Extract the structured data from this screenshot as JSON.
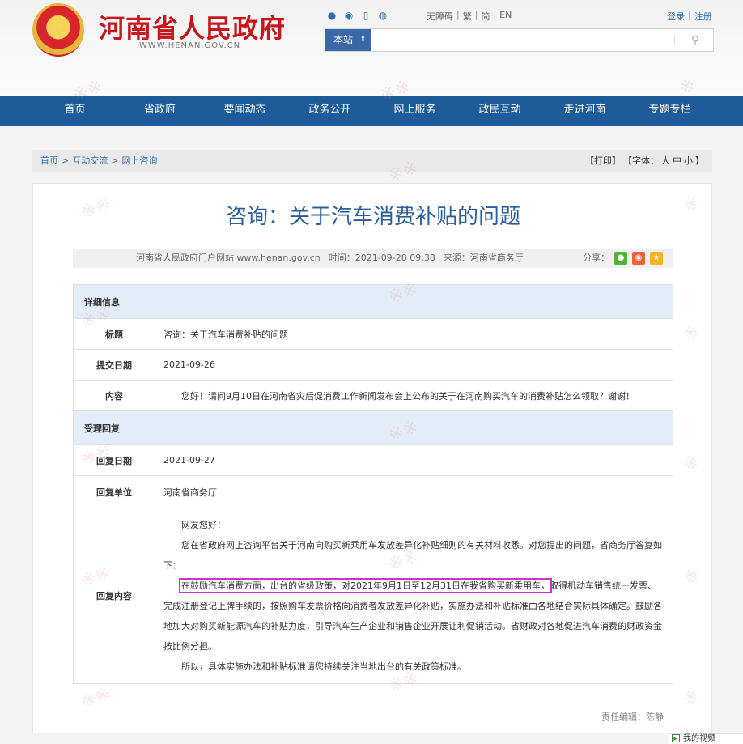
{
  "header": {
    "site_title": "河南省人民政府",
    "site_url": "WWW.HENAN.GOV.CN",
    "icons": [
      "wechat-icon",
      "weibo-icon",
      "mobile-icon",
      "app-icon"
    ],
    "accessibility": "无障碍",
    "traditional": "繁",
    "simplified": "简",
    "english": "EN",
    "login": "登录",
    "register": "注册",
    "search_scope": "本站",
    "search_placeholder": ""
  },
  "nav": {
    "items": [
      "首页",
      "省政府",
      "要闻动态",
      "政务公开",
      "网上服务",
      "政民互动",
      "走进河南",
      "专题专栏"
    ]
  },
  "breadcrumb": {
    "items": [
      "首页",
      "互动交流",
      "网上咨询"
    ],
    "print": "【打印】",
    "font_label": "【字体：",
    "font_large": "大",
    "font_medium": "中",
    "font_small": "小",
    "font_close": "】"
  },
  "article": {
    "title": "咨询：关于汽车消费补贴的问题",
    "source_site": "河南省人民政府门户网站 www.henan.gov.cn",
    "time": "时间：2021-09-28 09:38",
    "source": "来源：河南省商务厅",
    "share_label": "分享："
  },
  "details": {
    "section_title": "详细信息",
    "title_label": "标题",
    "title_value": "咨询：关于汽车消费补贴的问题",
    "date_label": "提交日期",
    "date_value": "2021-09-26",
    "content_label": "内容",
    "content_value": "您好！请问9月10日在河南省灾后促消费工作新闻发布会上公布的关于在河南购买汽车的消费补贴怎么领取？谢谢！"
  },
  "reply": {
    "section_title": "受理回复",
    "date_label": "回复日期",
    "date_value": "2021-09-27",
    "unit_label": "回复单位",
    "unit_value": "河南省商务厅",
    "content_label": "回复内容",
    "greeting": "网友您好！",
    "para1": "您在省政府网上咨询平台关于河南向购买新乘用车发放差异化补贴细则的有关材料收悉。对您提出的问题，省商务厅答复如下：",
    "para2_highlight": "在鼓励汽车消费方面，出台的省级政策，对2021年9月1日至12月31日在我省购买新乘用车，",
    "para2_rest": "取得机动车销售统一发票、完成注册登记上牌手续的，按照购车发票价格向消费者发放差异化补贴，实施办法和补贴标准由各地结合实际具体确定。鼓励各地加大对购买新能源汽车的补贴力度，引导汽车生产企业和销售企业开展让利促销活动。省财政对各地促进汽车消费的财政资金按比例分担。",
    "para3": "所以，具体实施办法和补贴标准请您持续关注当地出台的有关政策标准。"
  },
  "editor": "责任编辑：陈静",
  "mini_player": "我的视频"
}
